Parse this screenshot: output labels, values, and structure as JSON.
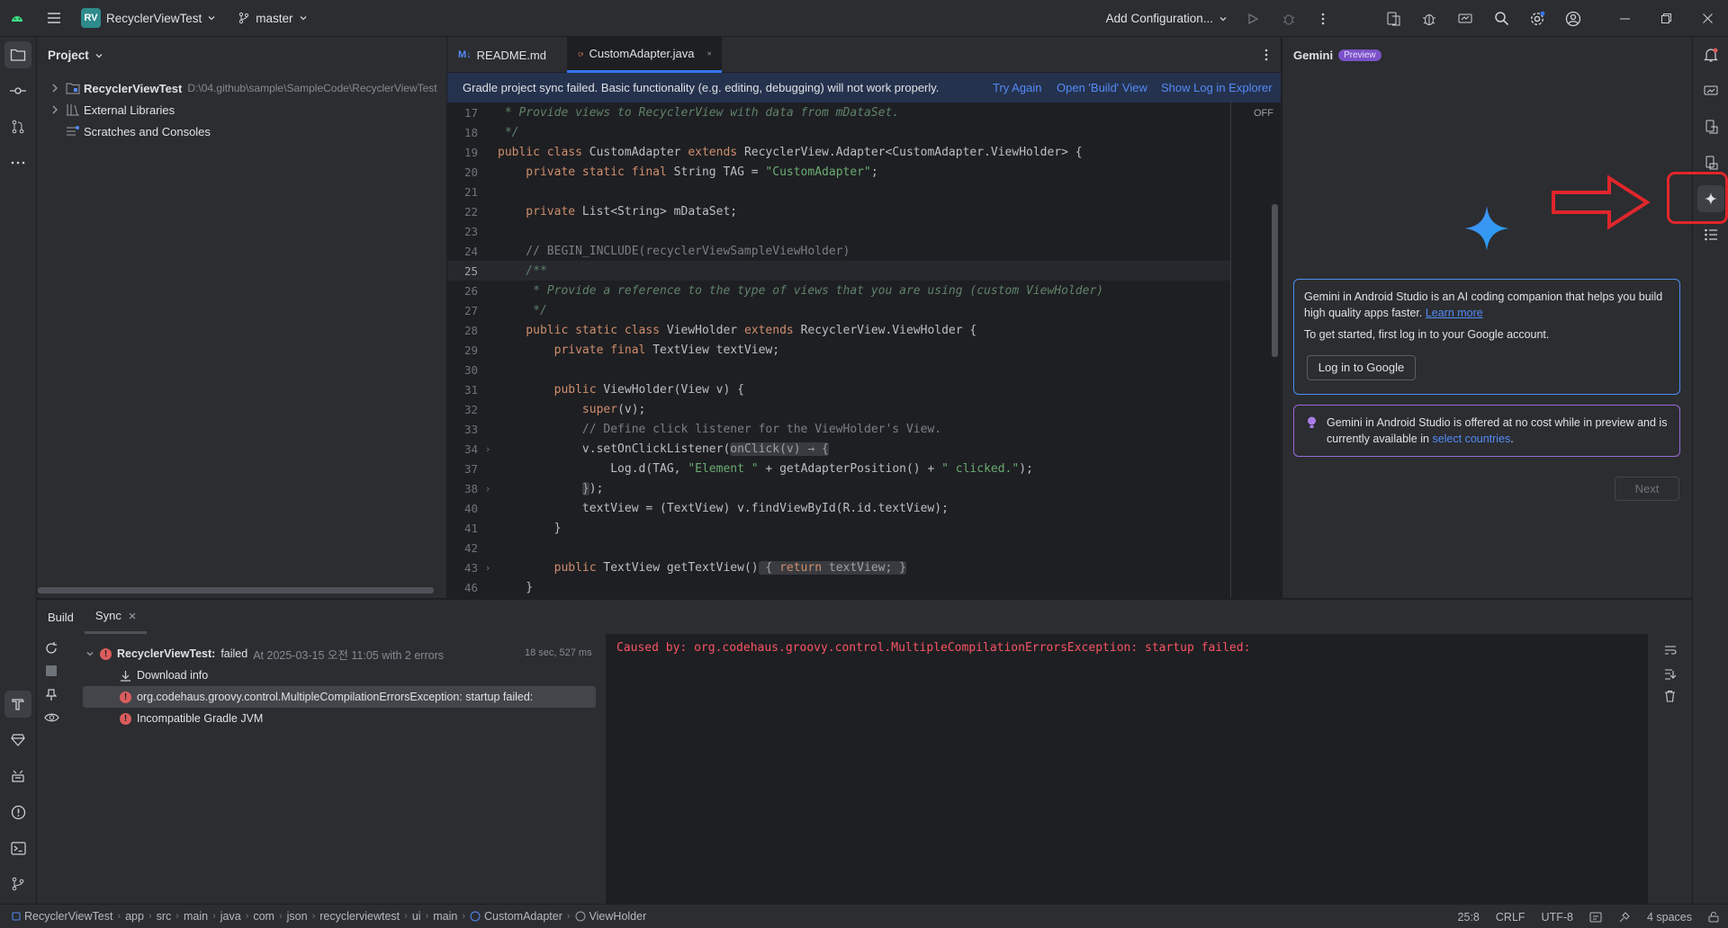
{
  "titlebar": {
    "project_badge": "RV",
    "project_name": "RecyclerViewTest",
    "branch": "master",
    "run_config": "Add Configuration..."
  },
  "project_panel": {
    "title": "Project",
    "items": [
      {
        "label": "RecyclerViewTest",
        "path": "D:\\04.github\\sample\\SampleCode\\RecyclerViewTest"
      },
      {
        "label": "External Libraries"
      },
      {
        "label": "Scratches and Consoles"
      }
    ]
  },
  "editor": {
    "tabs": [
      {
        "label": "README.md",
        "prefix": "M↓"
      },
      {
        "label": "CustomAdapter.java"
      }
    ],
    "banner": {
      "message": "Gradle project sync failed. Basic functionality (e.g. editing, debugging) will not work properly.",
      "try_again": "Try Again",
      "open_build": "Open 'Build' View",
      "show_log": "Show Log in Explorer"
    },
    "inspection_toggle": "OFF",
    "line_numbers": [
      "17",
      "18",
      "19",
      "20",
      "21",
      "22",
      "23",
      "24",
      "25",
      "26",
      "27",
      "28",
      "29",
      "30",
      "31",
      "32",
      "33",
      "34",
      "37",
      "38",
      "40",
      "41",
      "42",
      "43",
      "46"
    ],
    "current_line": "25",
    "code": {
      "l17": " * Provide views to RecyclerView with data from mDataSet.",
      "l18": " */",
      "l19_kw1": "public class ",
      "l19_name": "CustomAdapter ",
      "l19_kw2": "extends ",
      "l19_rest": "RecyclerView.Adapter<CustomAdapter.ViewHolder> {",
      "l20_kw": "    private static final ",
      "l20_type": "String TAG = ",
      "l20_str": "\"CustomAdapter\"",
      "l20_end": ";",
      "l22_kw": "    private ",
      "l22_rest": "List<String> mDataSet;",
      "l24": "    // BEGIN_INCLUDE(recyclerViewSampleViewHolder)",
      "l25": "    /**",
      "l26": "     * Provide a reference to the type of views that you are using (custom ViewHolder)",
      "l27": "     */",
      "l28_kw1": "    public static class ",
      "l28_name": "ViewHolder ",
      "l28_kw2": "extends ",
      "l28_rest": "RecyclerView.ViewHolder {",
      "l29_kw": "        private final ",
      "l29_rest": "TextView textView;",
      "l31_kw": "        public ",
      "l31_rest": "ViewHolder(View v) {",
      "l32_kw": "            super",
      "l32_rest": "(v);",
      "l33": "            // Define click listener for the ViewHolder's View.",
      "l34_code": "            v.setOnClickListener(",
      "l34_hint": "onClick(v) → {",
      "l37_code": "                Log.d(TAG, ",
      "l37_str1": "\"Element \"",
      "l37_mid": " + getAdapterPosition() + ",
      "l37_str2": "\" clicked.\"",
      "l37_end": ");",
      "l38_hint": "}",
      "l38_end": ");",
      "l40": "            textView = (TextView) v.findViewById(R.id.textView);",
      "l41": "        }",
      "l43_kw": "        public ",
      "l43_rest": "TextView getTextView()",
      "l43_hint_open": " { ",
      "l43_hint_kw": "return ",
      "l43_hint_rest": "textView; }",
      "l46": "    }"
    }
  },
  "gemini": {
    "title": "Gemini",
    "badge": "Preview",
    "intro_text": "Gemini in Android Studio is an AI coding companion that helps you build high quality apps faster.",
    "learn_more": "Learn more",
    "get_started": "To get started, first log in to your Google account.",
    "login_button": "Log in to Google",
    "notice_text": "Gemini in Android Studio is offered at no cost while in preview and is currently available in",
    "select_countries": "select countries",
    "notice_end": ".",
    "next_button": "Next",
    "accent_color": "#4c8df6",
    "notice_border": "#9b6bd8"
  },
  "build": {
    "tabs": [
      {
        "label": "Build"
      },
      {
        "label": "Sync"
      }
    ],
    "root_name": "RecyclerViewTest:",
    "root_status": "failed",
    "root_detail": "At 2025-03-15 오전 11:05 with 2 errors",
    "root_time": "18 sec, 527 ms",
    "items": [
      {
        "label": "Download info"
      },
      {
        "label": "org.codehaus.groovy.control.MultipleCompilationErrorsException: startup failed:"
      },
      {
        "label": "Incompatible Gradle JVM"
      }
    ],
    "console_line": "Caused by: org.codehaus.groovy.control.MultipleCompilationErrorsException: startup failed:"
  },
  "statusbar": {
    "breadcrumbs": [
      "RecyclerViewTest",
      "app",
      "src",
      "main",
      "java",
      "com",
      "json",
      "recyclerviewtest",
      "ui",
      "main",
      "CustomAdapter",
      "ViewHolder"
    ],
    "position": "25:8",
    "line_separator": "CRLF",
    "encoding": "UTF-8",
    "indent": "4 spaces"
  },
  "annotation": {
    "highlight_color": "#e0262b",
    "target": "gemini-toolwindow-button"
  }
}
